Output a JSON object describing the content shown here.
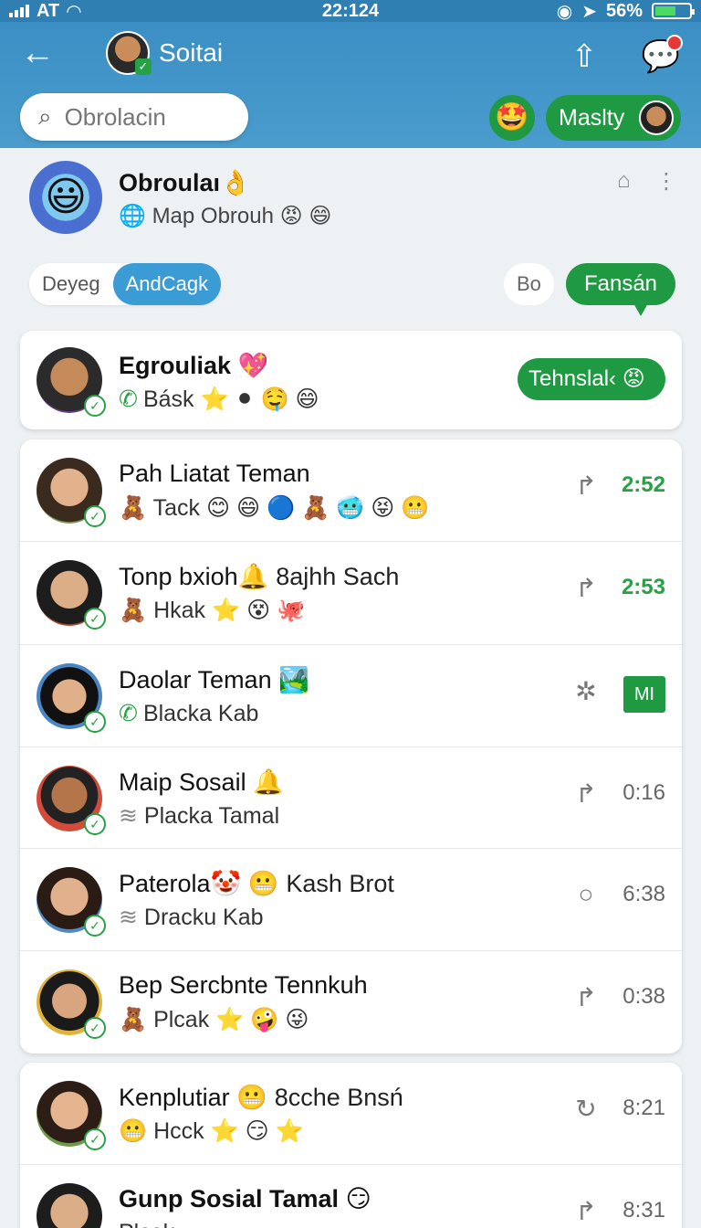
{
  "status": {
    "carrier": "AT",
    "time": "22:124",
    "battery": "56%"
  },
  "header": {
    "title": "Soitai",
    "search_placeholder": "Obrolacin",
    "user_pill_label": "Maslty"
  },
  "group": {
    "name": "Obroulaı",
    "subtitle": "Map Obrouh",
    "name_emoji": "👌",
    "subtitle_emoji": "😡 😄"
  },
  "filters": {
    "chips": [
      "Deyeg",
      "AndCagk"
    ],
    "bo": "Bo",
    "fansan": "Fansán"
  },
  "pinned": {
    "name": "Egrouliak",
    "name_emoji": "💖",
    "preview": "Básk",
    "preview_emoji": "⭐ ⚫ 🤤 😄",
    "action": "Tehnslal‹"
  },
  "chats": [
    {
      "name": "Pah Liatat Teman",
      "name_extra": "",
      "preview": "Tack",
      "preview_emoji": "😊 😄 🔵 🧸 🥶 😝 😬",
      "icon": "↱",
      "time": "2:52",
      "time_green": true
    },
    {
      "name": "Tonp bxioh",
      "name_extra": "8ajhh Sach",
      "preview": "Hkak",
      "preview_emoji": "⭐ 😵 🐙",
      "icon": "↱",
      "time": "2:53",
      "time_green": true
    },
    {
      "name": "Daolar Teman",
      "name_extra": "",
      "preview": "Blacka Kab",
      "preview_emoji": "",
      "icon": "✲",
      "time": "",
      "badge": "MI"
    },
    {
      "name": "Maip Sosail",
      "name_extra": "",
      "preview": "Placka Tamal",
      "preview_emoji": "",
      "icon": "↱",
      "time": "0:16"
    },
    {
      "name": "Paterola",
      "name_extra": "Kash Brot",
      "preview": "Dracku Kab",
      "preview_emoji": "",
      "icon": "○",
      "time": "6:38"
    },
    {
      "name": "Bep Sercbnte Tennkuh",
      "name_extra": "",
      "preview": "Plcak",
      "preview_emoji": "⭐ 🤪 😜",
      "icon": "↱",
      "time": "0:38"
    },
    {
      "name": "Kenplutiar",
      "name_extra": "8cche Bnsń",
      "preview": "Hcck",
      "preview_emoji": "⭐ 😏 ⭐",
      "icon": "↻",
      "time": "8:21"
    },
    {
      "name": "Gunp Sosial Tamal",
      "name_extra": "",
      "preview": "Plcak",
      "preview_emoji": "",
      "icon": "↱",
      "time": "8:31"
    }
  ]
}
